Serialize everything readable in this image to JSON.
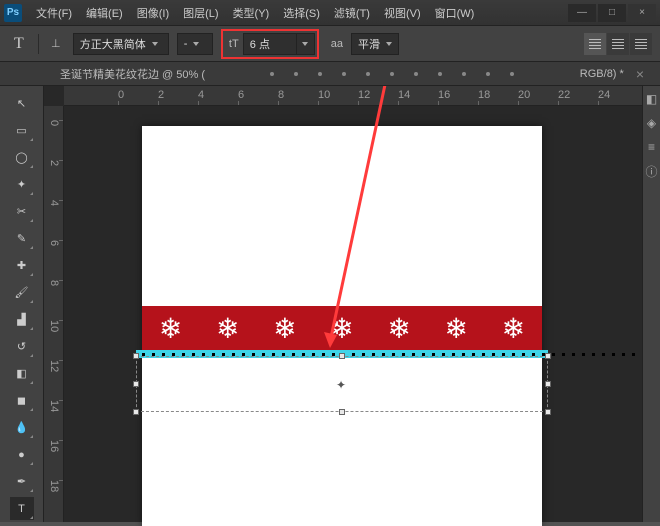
{
  "app": {
    "logo": "Ps"
  },
  "menu": {
    "file": "文件(F)",
    "edit": "编辑(E)",
    "image": "图像(I)",
    "layer": "图层(L)",
    "type": "类型(Y)",
    "select": "选择(S)",
    "filter": "滤镜(T)",
    "view": "视图(V)",
    "window": "窗口(W)"
  },
  "win": {
    "min": "—",
    "max": "□",
    "close": "×"
  },
  "options": {
    "tool": "T",
    "font": "方正大黑简体",
    "style": "-",
    "size_icon": "tT",
    "size": "6 点",
    "aa_label": "aa",
    "alias": "平滑"
  },
  "tab": {
    "title": "圣诞节精美花纹花边 @ 50% (",
    "info": "RGB/8) *",
    "close": "×"
  },
  "ruler_h": [
    {
      "v": "0",
      "p": 54
    },
    {
      "v": "2",
      "p": 94
    },
    {
      "v": "4",
      "p": 134
    },
    {
      "v": "6",
      "p": 174
    },
    {
      "v": "8",
      "p": 214
    },
    {
      "v": "10",
      "p": 254
    },
    {
      "v": "12",
      "p": 294
    },
    {
      "v": "14",
      "p": 334
    },
    {
      "v": "16",
      "p": 374
    },
    {
      "v": "18",
      "p": 414
    },
    {
      "v": "20",
      "p": 454
    },
    {
      "v": "22",
      "p": 494
    },
    {
      "v": "24",
      "p": 534
    }
  ],
  "ruler_v": [
    {
      "v": "0",
      "p": 14
    },
    {
      "v": "2",
      "p": 54
    },
    {
      "v": "4",
      "p": 94
    },
    {
      "v": "6",
      "p": 134
    },
    {
      "v": "8",
      "p": 174
    },
    {
      "v": "10",
      "p": 214
    },
    {
      "v": "12",
      "p": 254
    },
    {
      "v": "14",
      "p": 294
    },
    {
      "v": "16",
      "p": 334
    },
    {
      "v": "18",
      "p": 374
    }
  ],
  "tools": [
    "move",
    "marquee",
    "lasso",
    "wand",
    "crop",
    "eyedropper",
    "healing",
    "brush",
    "stamp",
    "history",
    "eraser",
    "gradient",
    "blur",
    "dodge",
    "pen",
    "type"
  ],
  "tool_glyphs": {
    "move": "↖",
    "marquee": "▭",
    "lasso": "◯",
    "wand": "✦",
    "crop": "✂",
    "eyedropper": "✎",
    "healing": "✚",
    "brush": "🖌",
    "stamp": "▟",
    "history": "↺",
    "eraser": "◧",
    "gradient": "◼",
    "blur": "💧",
    "dodge": "●",
    "pen": "✒",
    "type": "T"
  }
}
